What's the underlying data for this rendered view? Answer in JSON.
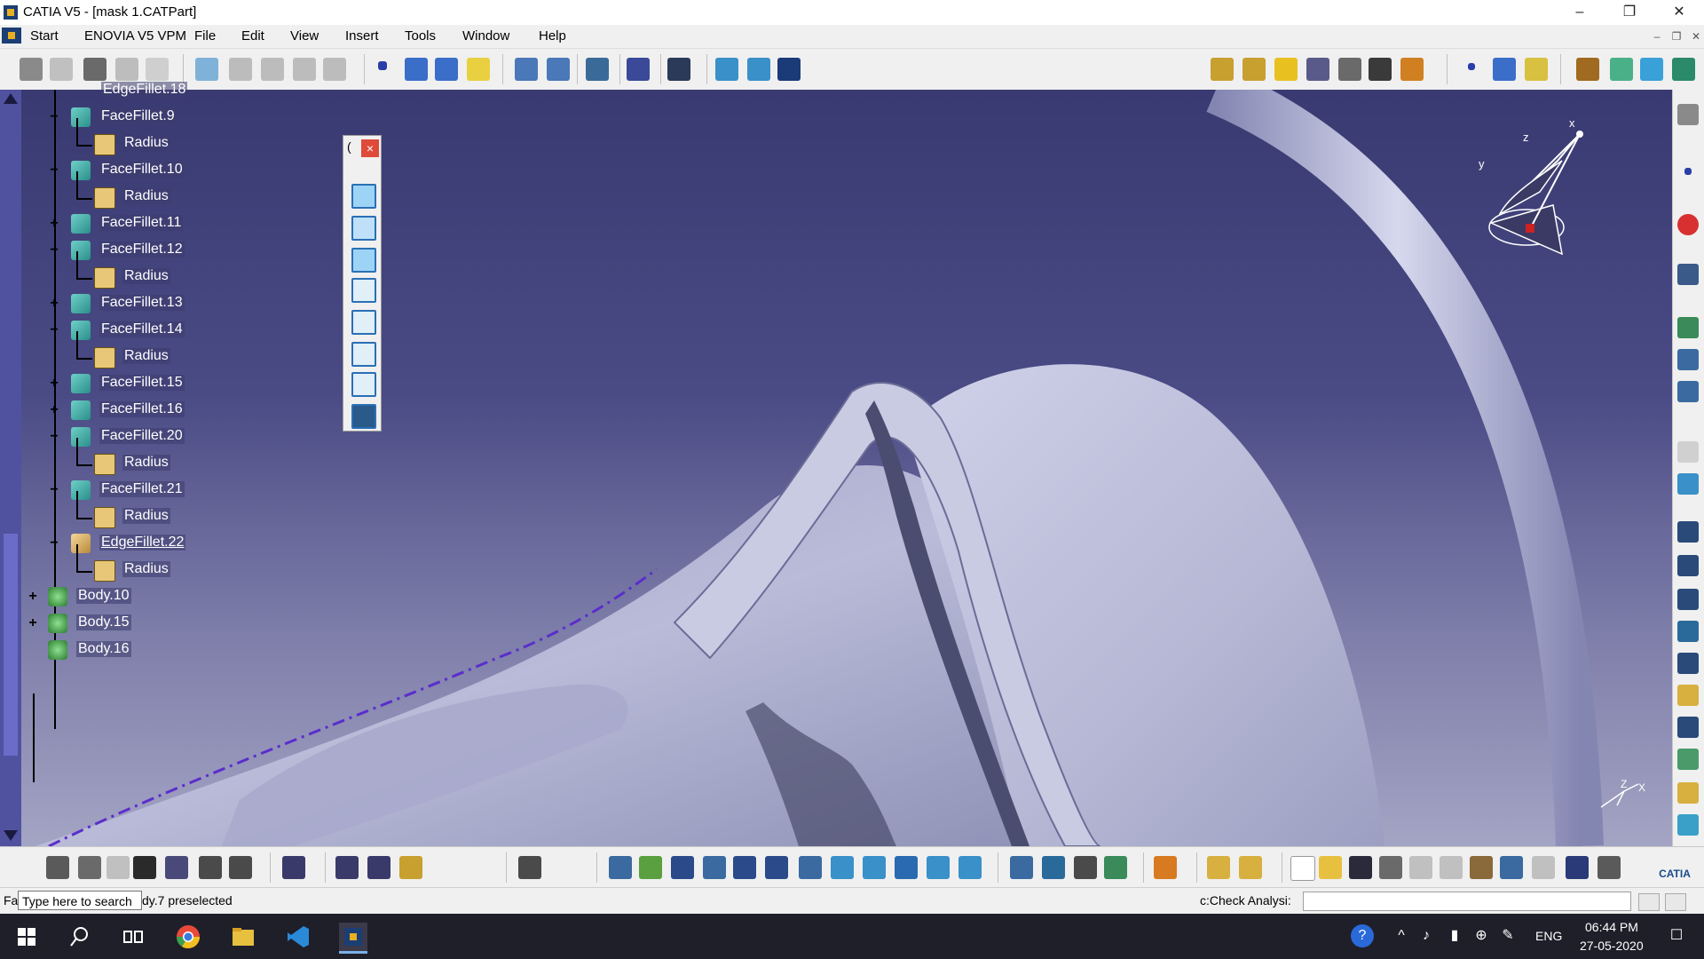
{
  "window": {
    "title": "CATIA V5 - [mask 1.CATPart]",
    "minimize_icon": "minimize-icon",
    "restore_icon": "restore-icon",
    "close_icon": "close-icon"
  },
  "menubar": {
    "items": [
      "Start",
      "ENOVIA V5 VPM",
      "File",
      "Edit",
      "View",
      "Insert",
      "Tools",
      "Window",
      "Help"
    ]
  },
  "tree": {
    "top_partial_label": "EdgeFillet.18",
    "nodes": [
      {
        "label": "FaceFillet.9",
        "kind": "fillet",
        "expander": "−"
      },
      {
        "label": "Radius",
        "kind": "radius"
      },
      {
        "label": "FaceFillet.10",
        "kind": "fillet",
        "expander": "−"
      },
      {
        "label": "Radius",
        "kind": "radius"
      },
      {
        "label": "FaceFillet.11",
        "kind": "fillet",
        "expander": "+"
      },
      {
        "label": "FaceFillet.12",
        "kind": "fillet",
        "expander": "−"
      },
      {
        "label": "Radius",
        "kind": "radius"
      },
      {
        "label": "FaceFillet.13",
        "kind": "fillet",
        "expander": "+"
      },
      {
        "label": "FaceFillet.14",
        "kind": "fillet",
        "expander": "−"
      },
      {
        "label": "Radius",
        "kind": "radius"
      },
      {
        "label": "FaceFillet.15",
        "kind": "fillet",
        "expander": "+"
      },
      {
        "label": "FaceFillet.16",
        "kind": "fillet",
        "expander": "+"
      },
      {
        "label": "FaceFillet.20",
        "kind": "fillet",
        "expander": "−"
      },
      {
        "label": "Radius",
        "kind": "radius"
      },
      {
        "label": "FaceFillet.21",
        "kind": "fillet",
        "expander": "−"
      },
      {
        "label": "Radius",
        "kind": "radius"
      },
      {
        "label": "EdgeFillet.22",
        "kind": "edge",
        "expander": "−",
        "selected": true
      },
      {
        "label": "Radius",
        "kind": "radius"
      },
      {
        "label": "Body.10",
        "kind": "body",
        "expander": "+"
      },
      {
        "label": "Body.15",
        "kind": "body",
        "expander": "+"
      },
      {
        "label": "Body.16",
        "kind": "body"
      }
    ]
  },
  "palette": {
    "title": "(",
    "close": "×",
    "buttons": [
      "isometric-view-icon",
      "front-view-icon",
      "back-view-icon",
      "left-view-icon",
      "right-view-icon",
      "top-view-icon",
      "bottom-view-icon",
      "named-views-icon"
    ]
  },
  "compass": {
    "x": "x",
    "y": "y",
    "z": "z"
  },
  "axis_triad": {
    "x": "X",
    "z": "Z"
  },
  "statusbar": {
    "prefix": "Fa",
    "search_placeholder": "Type here to search",
    "message": "dy.7 preselected",
    "command_label": "c:Check Analysi:"
  },
  "taskbar": {
    "language": "ENG",
    "time": "06:44 PM",
    "date": "27-05-2020"
  },
  "colors": {
    "viewport_top": "#3a3a72",
    "viewport_bottom": "#a4a4c4",
    "model_surface": "#c4c6e0",
    "tree_scroll": "#5052a0",
    "curve_dashed": "#5a2ecc"
  }
}
